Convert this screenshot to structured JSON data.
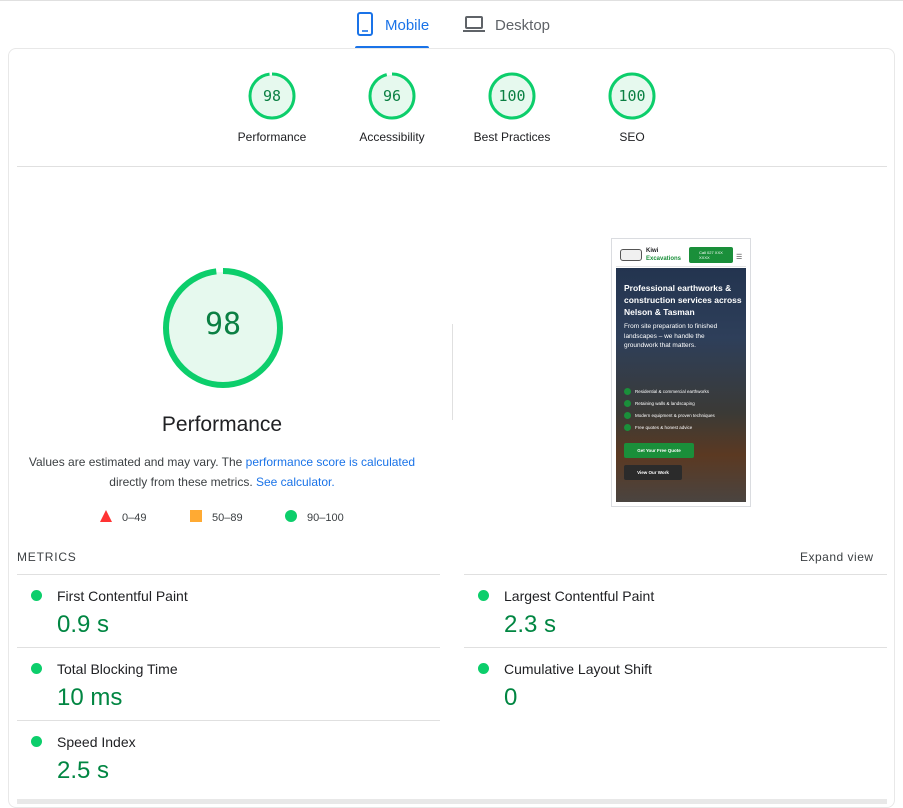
{
  "tabs": {
    "mobile": {
      "label": "Mobile",
      "icon": "smartphone-icon",
      "active": true
    },
    "desktop": {
      "label": "Desktop",
      "icon": "laptop-icon",
      "active": false
    }
  },
  "categories": [
    {
      "name": "Performance",
      "score": "98"
    },
    {
      "name": "Accessibility",
      "score": "96"
    },
    {
      "name": "Best Practices",
      "score": "100"
    },
    {
      "name": "SEO",
      "score": "100"
    }
  ],
  "performance": {
    "score": "98",
    "title": "Performance",
    "desc_prefix": "Values are estimated and may vary. The ",
    "desc_link1": "performance score is calculated",
    "desc_middle": " directly from these metrics. ",
    "desc_link2": "See calculator.",
    "legend": [
      {
        "range": "0–49",
        "shape": "triangle",
        "color": "#ff3333"
      },
      {
        "range": "50–89",
        "shape": "square",
        "color": "#ffaa33"
      },
      {
        "range": "90–100",
        "shape": "circle",
        "color": "#0cce6b"
      }
    ]
  },
  "screenshot": {
    "brand_line1": "Kiwi",
    "brand_line2": "Excavations",
    "call": "Call 027 XXX XXXX",
    "headline": "Professional earthworks & construction services across Nelson & Tasman",
    "paragraph": "From site preparation to finished landscapes – we handle the groundwork that matters.",
    "list": [
      "Residential & commercial earthworks",
      "Retaining walls & landscaping",
      "Modern equipment & proven techniques",
      "Free quotes & honest advice"
    ],
    "cta_primary": "Get Your Free Quote",
    "cta_secondary": "View Our Work"
  },
  "metrics": {
    "label": "METRICS",
    "expand": "Expand view",
    "items": [
      {
        "name": "First Contentful Paint",
        "value": "0.9 s"
      },
      {
        "name": "Largest Contentful Paint",
        "value": "2.3 s"
      },
      {
        "name": "Total Blocking Time",
        "value": "10 ms"
      },
      {
        "name": "Cumulative Layout Shift",
        "value": "0"
      },
      {
        "name": "Speed Index",
        "value": "2.5 s"
      }
    ]
  },
  "colors": {
    "accent": "#1a73e8",
    "pass": "#0cce6b",
    "pass_text": "#018642"
  }
}
